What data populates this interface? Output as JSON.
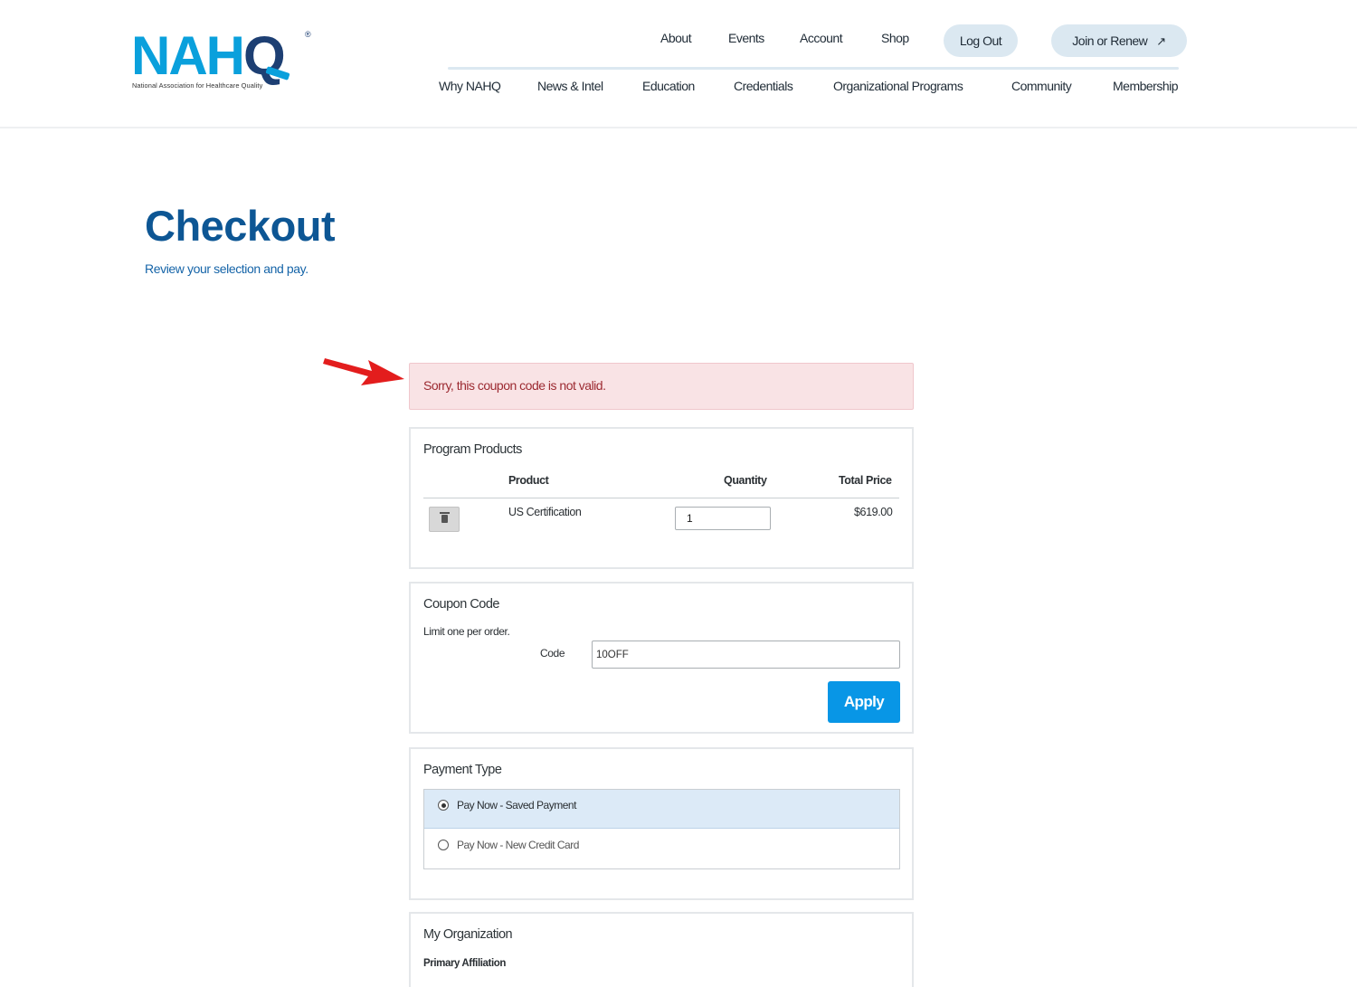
{
  "header": {
    "logo": {
      "letters_left": "NAH",
      "letters_right": "Q",
      "registered": "®",
      "tagline": "National Association for Healthcare Quality"
    },
    "utility_nav": [
      "About",
      "Events",
      "Account",
      "Shop"
    ],
    "logout_label": "Log Out",
    "join_label": "Join or Renew",
    "join_icon": "↗",
    "main_nav": [
      "Why NAHQ",
      "News & Intel",
      "Education",
      "Credentials",
      "Organizational Programs",
      "Community",
      "Membership"
    ]
  },
  "page": {
    "title": "Checkout",
    "subtitle": "Review your selection and pay."
  },
  "error": {
    "message": "Sorry, this coupon code is not valid."
  },
  "program_products": {
    "title": "Program Products",
    "columns": {
      "product": "Product",
      "quantity": "Quantity",
      "total_price": "Total Price"
    },
    "rows": [
      {
        "product": "US Certification",
        "quantity": "1",
        "total_price": "$619.00"
      }
    ]
  },
  "coupon": {
    "title": "Coupon Code",
    "note": "Limit one per order.",
    "code_label": "Code",
    "code_value": "10OFF",
    "apply_label": "Apply"
  },
  "payment": {
    "title": "Payment Type",
    "options": [
      {
        "label": "Pay Now - Saved Payment",
        "selected": true
      },
      {
        "label": "Pay Now - New Credit Card",
        "selected": false
      }
    ]
  },
  "organization": {
    "title": "My Organization",
    "primary_affiliation_label": "Primary Affiliation"
  },
  "colors": {
    "brand_blue": "#0d5694",
    "logo_cyan": "#0aa0dc",
    "apply_button": "#0896e6",
    "error_bg": "#f9e3e5",
    "error_text": "#9c2a31",
    "pill_bg": "#dbe8f1"
  }
}
